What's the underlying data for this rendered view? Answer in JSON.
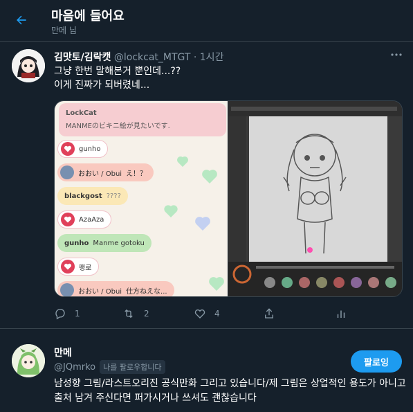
{
  "colors": {
    "accent": "#1d9bf0",
    "background": "#15202b",
    "muted": "#8899a6",
    "divider": "#38444d"
  },
  "header": {
    "title": "마음에 들어요",
    "subtitle": "만메 님"
  },
  "tweet": {
    "display_name": "김맛토/김락캣",
    "handle": "@lockcat_MTGT",
    "time": "· 1시간",
    "text_line1": "그냥 한번 말해본거 뿐인데...??",
    "text_line2": "이게 진짜가 되버렸네...",
    "media_chat": [
      {
        "user": "LockCat",
        "message": "MANMEのビキニ絵が見たいです."
      },
      {
        "user": "gunho",
        "message": ""
      },
      {
        "user": "おおい / Obui",
        "message": "え！？"
      },
      {
        "user": "blackgost",
        "message": "????"
      },
      {
        "user": "AzaAza",
        "message": ""
      },
      {
        "user": "gunho",
        "message": "Manme gotoku"
      },
      {
        "user": "팽로",
        "message": ""
      },
      {
        "user": "おおい / Obui",
        "message": "仕方ねえな..."
      }
    ],
    "actions": {
      "replies": "1",
      "retweets": "2",
      "likes": "4"
    }
  },
  "follower": {
    "display_name": "만메",
    "handle": "@JQmrko",
    "follows_you": "나를 팔로우합니다",
    "follow_button": "팔로잉",
    "bio": "남성향 그림/라스트오리진 공식만화 그리고 있습니다/제 그림은 상업적인 용도가 아니고 출처 남겨 주신다면 퍼가시거나 쓰셔도 괜찮습니다"
  },
  "icons": [
    "back-arrow-icon",
    "more-icon",
    "reply-icon",
    "retweet-icon",
    "like-icon",
    "share-icon",
    "heart-icon"
  ]
}
